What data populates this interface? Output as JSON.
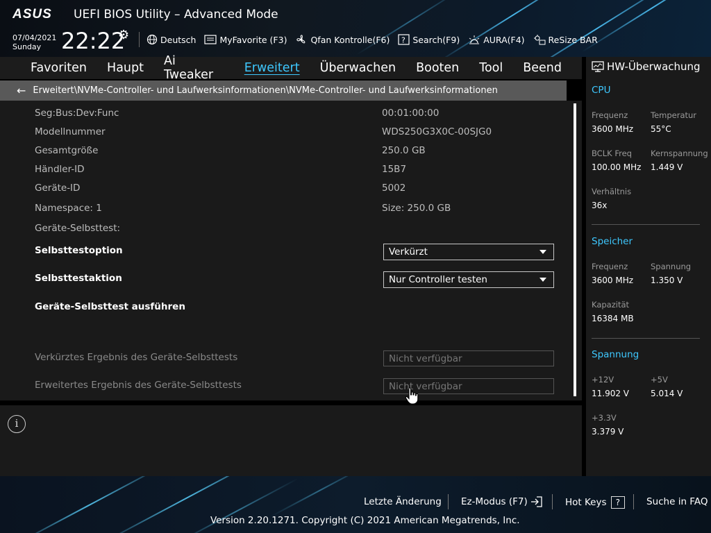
{
  "header": {
    "logo_text": "ASUS",
    "title": "UEFI BIOS Utility – Advanced Mode",
    "date": "07/04/2021",
    "day": "Sunday",
    "time": "22:22",
    "toolbar": [
      {
        "label": "Deutsch",
        "icon": "globe-icon"
      },
      {
        "label": "MyFavorite (F3)",
        "icon": "myfavorite-icon"
      },
      {
        "label": "Qfan Kontrolle(F6)",
        "icon": "fan-icon"
      },
      {
        "label": "Search(F9)",
        "icon": "search-icon"
      },
      {
        "label": "AURA(F4)",
        "icon": "aura-icon"
      },
      {
        "label": "ReSize BAR",
        "icon": "resize-bar-icon"
      }
    ]
  },
  "nav": {
    "tabs": [
      "Favoriten",
      "Haupt",
      "Ai Tweaker",
      "Erweitert",
      "Überwachen",
      "Booten",
      "Tool",
      "Beend"
    ],
    "active": "Erweitert"
  },
  "breadcrumb": "Erweitert\\NVMe-Controller- und Laufwerksinformationen\\NVMe-Controller- und Laufwerksinformationen",
  "main": {
    "info_rows": [
      {
        "label": "Seg:Bus:Dev:Func",
        "value": "00:01:00:00"
      },
      {
        "label": "Modellnummer",
        "value": "WDS250G3X0C-00SJG0"
      },
      {
        "label": "Gesamtgröße",
        "value": "250.0 GB"
      },
      {
        "label": "Händler-ID",
        "value": "15B7"
      },
      {
        "label": "Geräte-ID",
        "value": "5002"
      },
      {
        "label": "Namespace: 1",
        "value": "Size: 250.0 GB"
      }
    ],
    "selftest_heading": "Geräte-Selbsttest:",
    "selftest_option": {
      "label": "Selbsttestoption",
      "value": "Verkürzt"
    },
    "selftest_action": {
      "label": "Selbsttestaktion",
      "value": "Nur Controller testen"
    },
    "run_selftest": "Geräte-Selbsttest ausführen",
    "short_result": {
      "label": "Verkürztes Ergebnis des Geräte-Selbsttests",
      "value": "Nicht verfügbar"
    },
    "extended_result": {
      "label": "Erweitertes Ergebnis des Geräte-Selbsttests",
      "value": "Nicht verfügbar"
    }
  },
  "hw_monitor": {
    "title": "HW-Überwachung",
    "cpu": {
      "title": "CPU",
      "freq_label": "Frequenz",
      "freq": "3600 MHz",
      "temp_label": "Temperatur",
      "temp": "55°C",
      "bclk_label": "BCLK Freq",
      "bclk": "100.00 MHz",
      "core_v_label": "Kernspannung",
      "core_v": "1.449 V",
      "ratio_label": "Verhältnis",
      "ratio": "36x"
    },
    "memory": {
      "title": "Speicher",
      "freq_label": "Frequenz",
      "freq": "3600 MHz",
      "volt_label": "Spannung",
      "volt": "1.350 V",
      "cap_label": "Kapazität",
      "cap": "16384 MB"
    },
    "voltage": {
      "title": "Spannung",
      "v12_label": "+12V",
      "v12": "11.902 V",
      "v5_label": "+5V",
      "v5": "5.014 V",
      "v33_label": "+3.3V",
      "v33": "3.379 V"
    }
  },
  "footer": {
    "last_change": "Letzte Änderung",
    "ez_mode": "Ez-Modus (F7)",
    "hot_keys": "Hot Keys",
    "hot_keys_key": "?",
    "faq": "Suche in FAQ",
    "copyright": "Version 2.20.1271. Copyright (C) 2021 American Megatrends, Inc."
  },
  "colors": {
    "accent": "#3ec8ff",
    "breadcrumb_bg": "#595959",
    "panel_bg": "#1a1a1a"
  }
}
